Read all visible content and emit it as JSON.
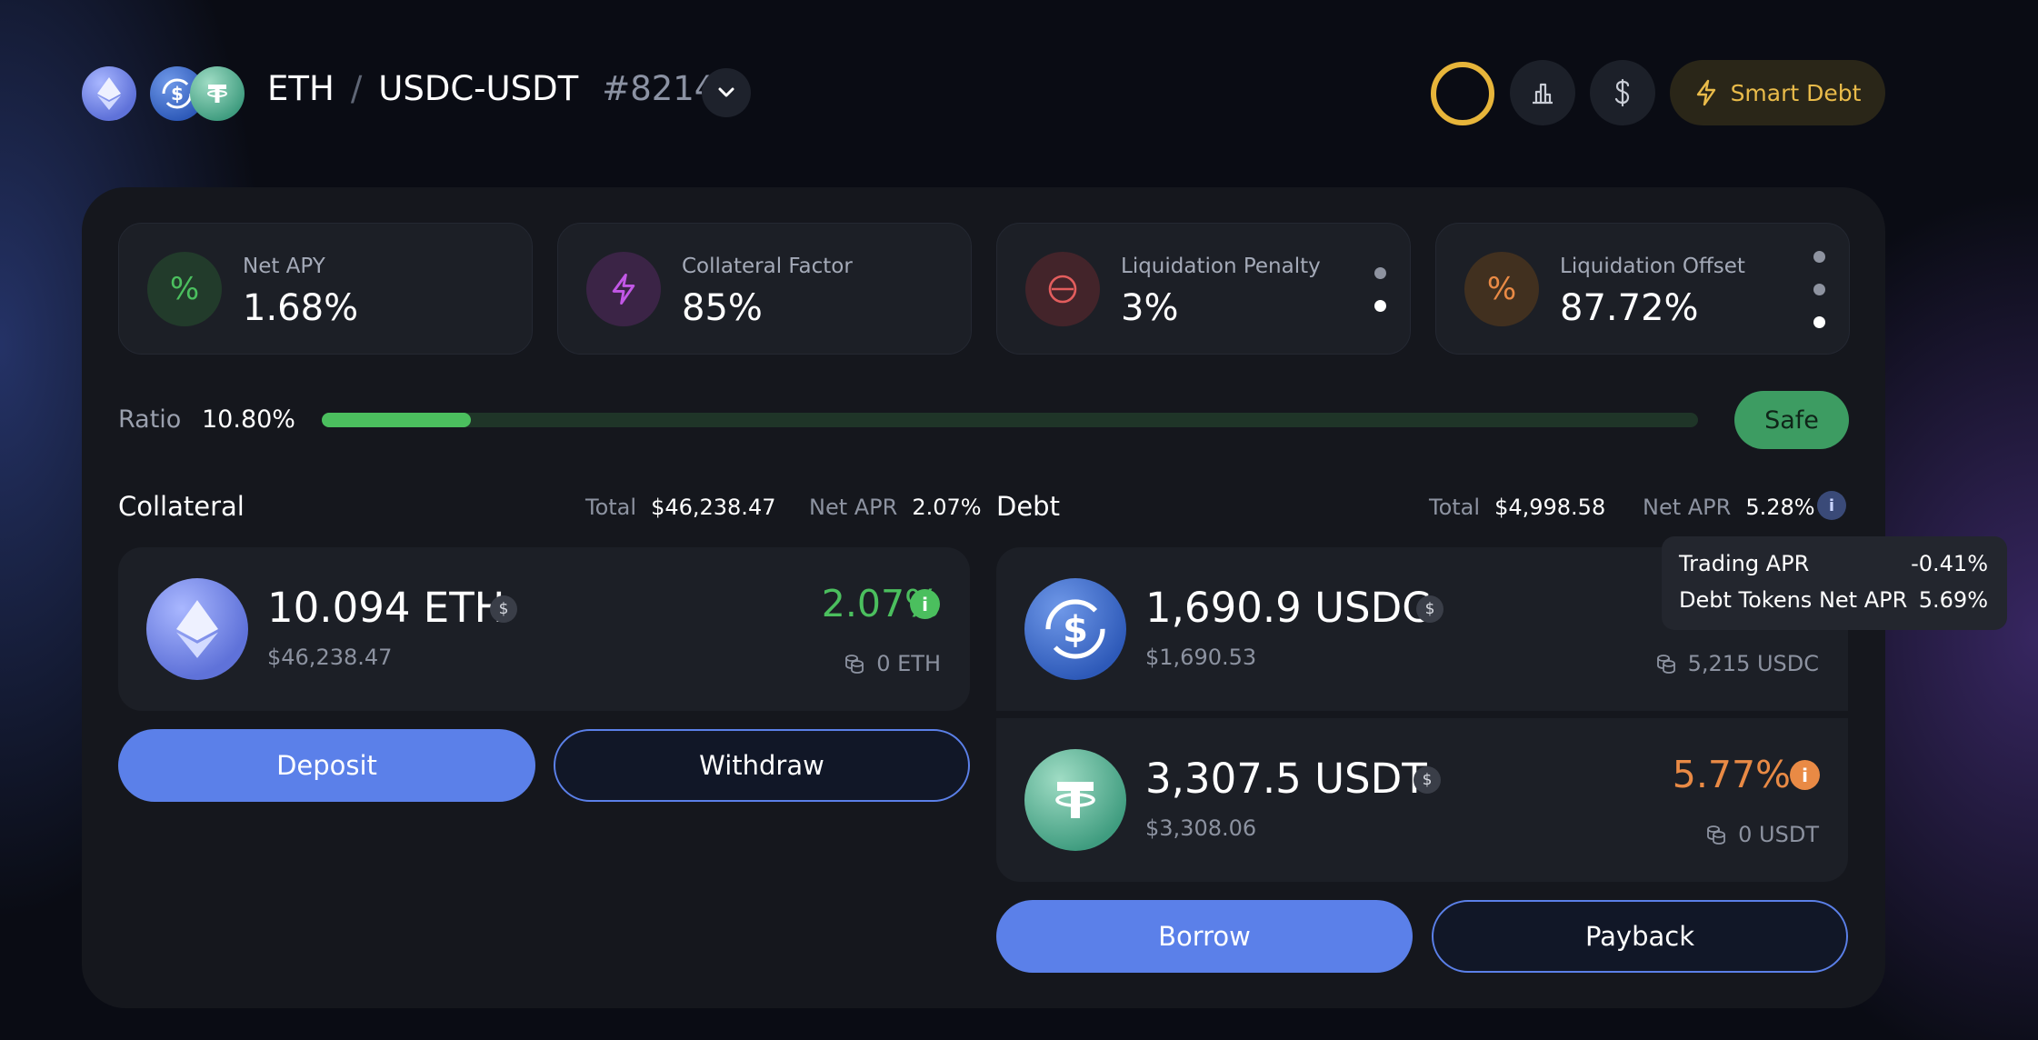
{
  "header": {
    "collateral_symbol": "ETH",
    "separator": "/",
    "debt_pair": "USDC-USDT",
    "position_id": "#8214",
    "smart_debt_label": "Smart Debt"
  },
  "stats": [
    {
      "label": "Net APY",
      "value": "1.68%",
      "icon": "percent-icon",
      "icon_color": "#4bbf5e"
    },
    {
      "label": "Collateral Factor",
      "value": "85%",
      "icon": "bolt-icon",
      "icon_color": "#c257e6"
    },
    {
      "label": "Liquidation Penalty",
      "value": "3%",
      "icon": "minus-circle-icon",
      "icon_color": "#e35d5d"
    },
    {
      "label": "Liquidation Offset",
      "value": "87.72%",
      "icon": "percent-icon",
      "icon_color": "#e98a45"
    }
  ],
  "ratio": {
    "label": "Ratio",
    "value": "10.80%",
    "fill_fraction": 0.108,
    "status": "Safe"
  },
  "collateral": {
    "title": "Collateral",
    "total_label": "Total",
    "total_value": "$46,238.47",
    "apr_label": "Net APR",
    "apr_value": "2.07%",
    "asset": {
      "amount": "10.094 ETH",
      "usd": "$46,238.47",
      "rate": "2.07%",
      "available": "0 ETH",
      "mini_badge": "$"
    },
    "deposit_label": "Deposit",
    "withdraw_label": "Withdraw"
  },
  "debt": {
    "title": "Debt",
    "total_label": "Total",
    "total_value": "$4,998.58",
    "apr_label": "Net APR",
    "apr_value": "5.28%",
    "assets": [
      {
        "amount": "1,690.9 USDC",
        "usd": "$1,690.53",
        "available": "5,215 USDC",
        "mini_badge": "$"
      },
      {
        "amount": "3,307.5 USDT",
        "usd": "$3,308.06",
        "rate": "5.77%",
        "available": "0 USDT",
        "mini_badge": "$"
      }
    ],
    "borrow_label": "Borrow",
    "payback_label": "Payback"
  },
  "tooltip": {
    "rows": [
      {
        "label": "Trading APR",
        "value": "-0.41%"
      },
      {
        "label": "Debt Tokens Net APR",
        "value": "5.69%"
      }
    ]
  },
  "colors": {
    "accent": "#5b80e9",
    "positive": "#4bbf5e",
    "warning": "#e98a45",
    "gold": "#e9bb4a"
  }
}
